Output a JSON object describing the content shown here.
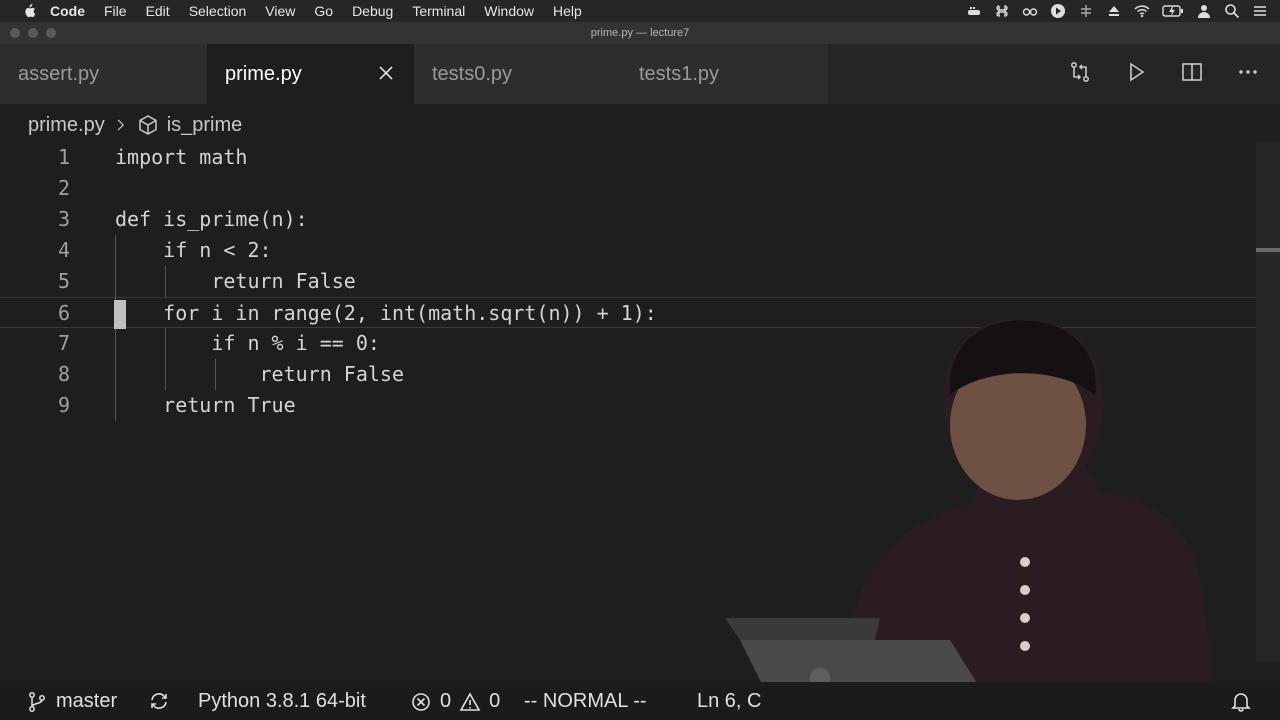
{
  "menubar": {
    "items": [
      "Code",
      "File",
      "Edit",
      "Selection",
      "View",
      "Go",
      "Debug",
      "Terminal",
      "Window",
      "Help"
    ]
  },
  "window": {
    "title": "prime.py — lecture7"
  },
  "tabs": [
    {
      "label": "assert.py",
      "active": false
    },
    {
      "label": "prime.py",
      "active": true
    },
    {
      "label": "tests0.py",
      "active": false
    },
    {
      "label": "tests1.py",
      "active": false
    }
  ],
  "breadcrumb": {
    "file": "prime.py",
    "symbol": "is_prime"
  },
  "editor": {
    "current_line": 6,
    "lines": [
      {
        "n": "1",
        "text": "import math"
      },
      {
        "n": "2",
        "text": ""
      },
      {
        "n": "3",
        "text": "def is_prime(n):"
      },
      {
        "n": "4",
        "text": "    if n < 2:"
      },
      {
        "n": "5",
        "text": "        return False"
      },
      {
        "n": "6",
        "text": "    for i in range(2, int(math.sqrt(n)) + 1):"
      },
      {
        "n": "7",
        "text": "        if n % i == 0:"
      },
      {
        "n": "8",
        "text": "            return False"
      },
      {
        "n": "9",
        "text": "    return True"
      }
    ]
  },
  "statusbar": {
    "branch": "master",
    "interpreter": "Python 3.8.1 64-bit",
    "errors": "0",
    "warnings": "0",
    "mode": "-- NORMAL --",
    "position": "Ln 6, C"
  },
  "colors": {
    "editor_bg": "#1e1e1e",
    "tab_bg": "#2d2d2d",
    "status_bg": "#1b1b1b"
  }
}
